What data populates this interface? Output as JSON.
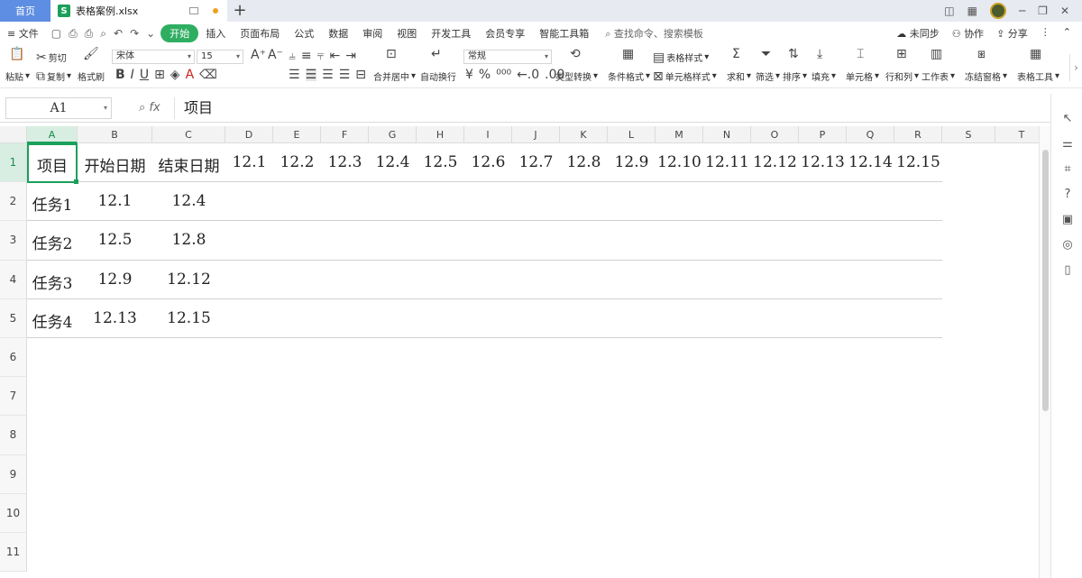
{
  "titlebar": {
    "home_tab": "首页",
    "file_tab": "表格案例.xlsx",
    "new_tab": "+"
  },
  "menu": {
    "file": "文件",
    "tabs": [
      "开始",
      "插入",
      "页面布局",
      "公式",
      "数据",
      "审阅",
      "视图",
      "开发工具",
      "会员专享",
      "智能工具箱"
    ],
    "search_placeholder": "查找命令、搜索模板",
    "sync": "未同步",
    "collab": "协作",
    "share": "分享"
  },
  "ribbon": {
    "paste": "粘贴",
    "cut": "剪切",
    "copy": "复制",
    "format_painter": "格式刷",
    "font_name": "宋体",
    "font_size": "15",
    "merge_center": "合并居中",
    "wrap_text": "自动换行",
    "number_format": "常规",
    "type_convert": "类型转换",
    "conditional_format": "条件格式",
    "table_style": "表格样式",
    "cell_style": "单元格样式",
    "sum": "求和",
    "filter": "筛选",
    "sort": "排序",
    "fill": "填充",
    "cell": "单元格",
    "row_col": "行和列",
    "worksheet": "工作表",
    "freeze": "冻结窗格",
    "table_tools": "表格工具"
  },
  "formula_bar": {
    "name_box": "A1",
    "fx": "fx",
    "content": "项目"
  },
  "sheet": {
    "columns": [
      "A",
      "B",
      "C",
      "D",
      "E",
      "F",
      "G",
      "H",
      "I",
      "J",
      "K",
      "L",
      "M",
      "N",
      "O",
      "P",
      "Q",
      "R",
      "S",
      "T"
    ],
    "rows": [
      "1",
      "2",
      "3",
      "4",
      "5",
      "6",
      "7",
      "8",
      "9",
      "10",
      "11"
    ],
    "header": [
      "项目",
      "开始日期",
      "结束日期",
      "12.1",
      "12.2",
      "12.3",
      "12.4",
      "12.5",
      "12.6",
      "12.7",
      "12.8",
      "12.9",
      "12.10",
      "12.11",
      "12.12",
      "12.13",
      "12.14",
      "12.15"
    ],
    "tasks": [
      [
        "任务1",
        "12.1",
        "12.4"
      ],
      [
        "任务2",
        "12.5",
        "12.8"
      ],
      [
        "任务3",
        "12.9",
        "12.12"
      ],
      [
        "任务4",
        "12.13",
        "12.15"
      ]
    ]
  }
}
